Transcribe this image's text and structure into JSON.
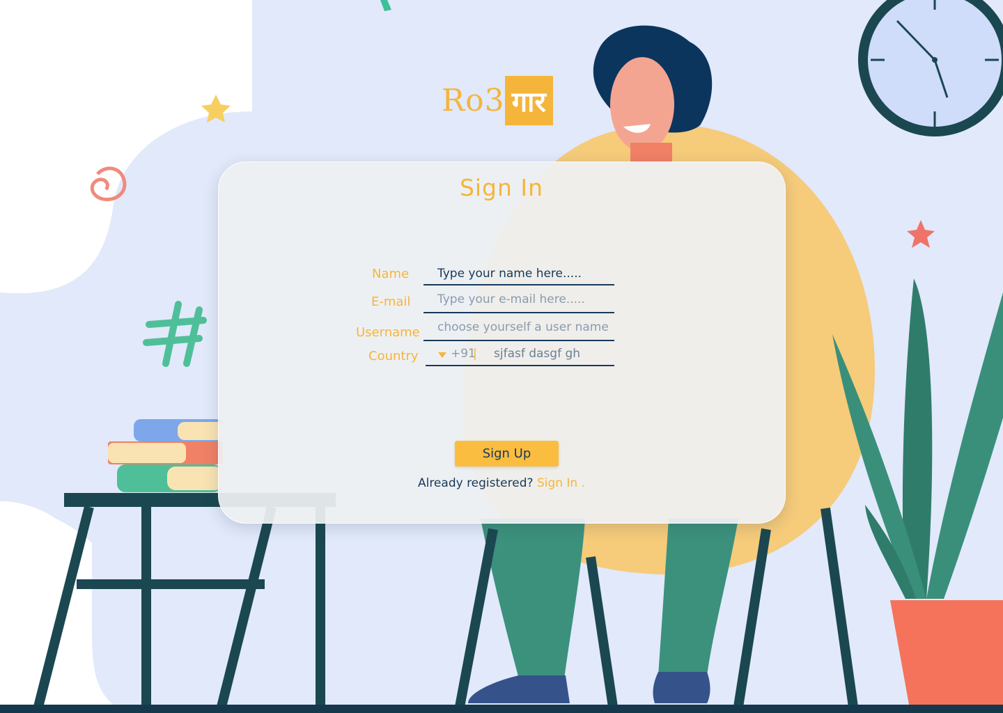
{
  "brand": {
    "latin": "Ro3",
    "devanagari": "गार"
  },
  "form": {
    "title": "Sign In",
    "fields": {
      "name": {
        "label": "Name",
        "placeholder": "Type your name here....."
      },
      "email": {
        "label": "E-mail",
        "placeholder": "Type your e-mail here....."
      },
      "username": {
        "label": "Username",
        "placeholder": "choose yourself a user name ....."
      },
      "country": {
        "label": "Country",
        "dial_code": "+91",
        "separator": "|",
        "phone_value": "sjfasf dasgf gh"
      }
    },
    "submit_label": "Sign Up",
    "footer": {
      "question": "Already registered?",
      "link_label": "Sign In ."
    }
  },
  "colors": {
    "accent": "#f5b53a",
    "navy": "#17395a",
    "button": "#fbbd40"
  },
  "icons": [
    "clock-icon",
    "star-icon",
    "hashtag-icon",
    "swirl-icon",
    "plant-icon",
    "books-icon",
    "dropdown-arrow-icon"
  ]
}
